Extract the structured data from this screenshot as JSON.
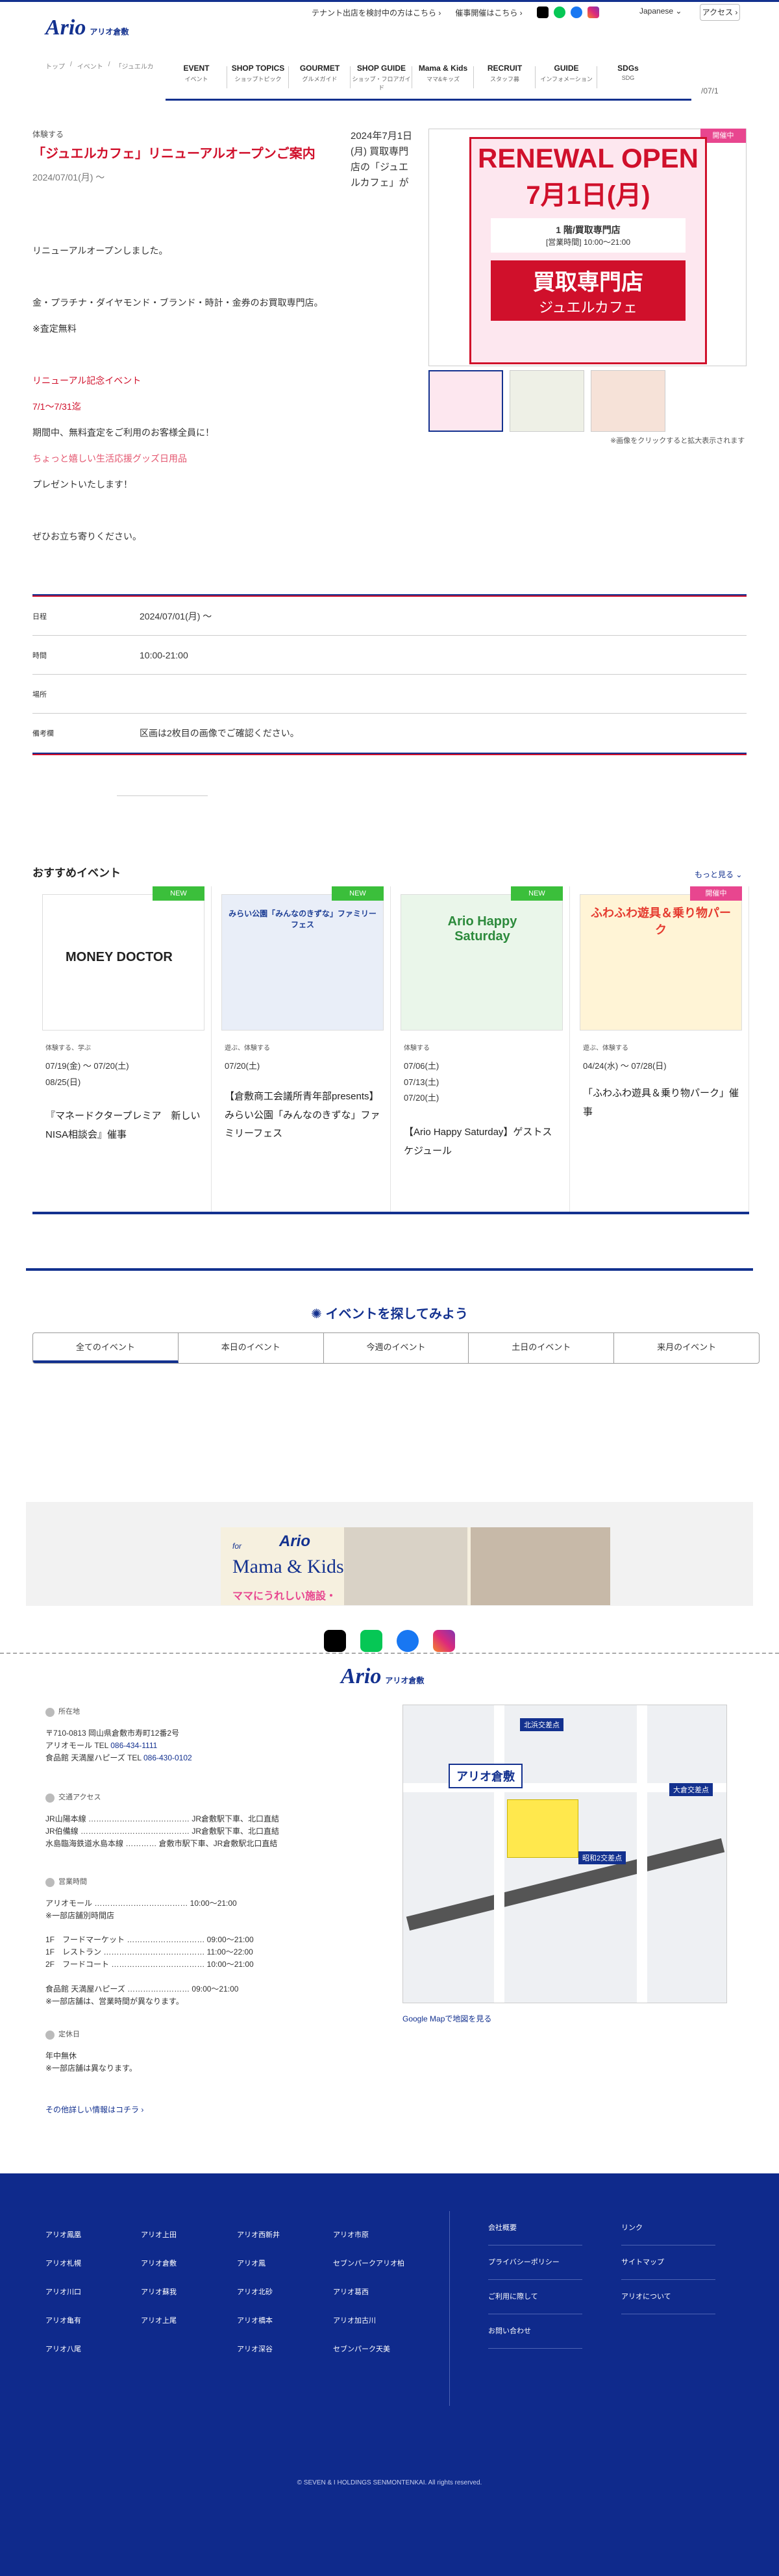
{
  "header": {
    "logo_mark": "Ario",
    "logo_sub": "アリオ倉敷",
    "tenant_link": "テナント出店を検討中の方はこちら ›",
    "venue_link": "催事開催はこちら ›",
    "language": "Japanese ⌄",
    "access": "アクセス ›"
  },
  "breadcrumb": [
    "トップ",
    "/",
    "イベント",
    "/",
    "「ジュエルカ"
  ],
  "gnav": [
    {
      "t": "EVENT",
      "s": "イベント"
    },
    {
      "t": "SHOP TOPICS",
      "s": "ショップトピック"
    },
    {
      "t": "GOURMET",
      "s": "グルメガイド"
    },
    {
      "t": "SHOP GUIDE",
      "s": "ショップ・フロアガイド"
    },
    {
      "t": "Mama & Kids",
      "s": "ママ&キッズ"
    },
    {
      "t": "RECRUIT",
      "s": "スタッフ募"
    },
    {
      "t": "GUIDE",
      "s": "インフォメーション"
    },
    {
      "t": "SDGs",
      "s": "SDG"
    }
  ],
  "header_date": "/07/1",
  "article": {
    "category": "体験する",
    "title": "「ジュエルカフェ」リニューアルオープンご案内",
    "date": "2024/07/01(月) 〜",
    "side_text": "2024年7月1日(月) 買取専門店の「ジュエルカフェ」が",
    "lines": [
      "リニューアルオープンしました。",
      "金・プラチナ・ダイヤモンド・ブランド・時計・金券のお買取専門店。",
      "※査定無料",
      "リニューアル記念イベント",
      "7/1〜7/31迄",
      "期間中、無料査定をご利用のお客様全員に！",
      "ちょっと嬉しい生活応援グッズ日用品",
      "プレゼントいたします！",
      "ぜひお立ち寄りください。"
    ],
    "badge": "開催中",
    "img_text": {
      "line1": "RENEWAL OPEN",
      "line2": "7月1日(月)",
      "floor": "1 階/買取専門店",
      "hours": "[営業時間] 10:00〜21:00",
      "big": "買取専門店",
      "name": "ジュエルカフェ"
    },
    "note": "※画像をクリックすると拡大表示されます"
  },
  "info": [
    {
      "k": "日程",
      "v": "2024/07/01(月) 〜"
    },
    {
      "k": "時間",
      "v": "10:00-21:00"
    },
    {
      "k": "場所",
      "v": ""
    },
    {
      "k": "備考欄",
      "v": "区画は2枚目の画像でご確認ください。"
    }
  ],
  "recommended": {
    "heading": "おすすめイベント",
    "more": "もっと見る ⌄",
    "cards": [
      {
        "badge": "NEW",
        "badge_color": "#3bbf3b",
        "cat": "体験する、学ぶ",
        "dates": [
          "07/19(金) 〜 07/20(土)",
          "08/25(日)"
        ],
        "name": "『マネードクタープレミア　新しいNISA相談会』催事",
        "img_text": "MONEY DOCTOR"
      },
      {
        "badge": "NEW",
        "badge_color": "#3bbf3b",
        "cat": "遊ぶ、体験する",
        "dates": [
          "07/20(土)"
        ],
        "name": "【倉敷商工会議所青年部presents】みらい公園「みんなのきずな」ファミリーフェス",
        "img_text": "みらい公園「みんなのきずな」ファミリーフェス"
      },
      {
        "badge": "NEW",
        "badge_color": "#3bbf3b",
        "cat": "体験する",
        "dates": [
          "07/06(土)",
          "07/13(土)",
          "07/20(土)"
        ],
        "name": "【Ario Happy Saturday】ゲストスケジュール",
        "img_text": "Ario Happy Saturday"
      },
      {
        "badge": "開催中",
        "badge_color": "#e8468f",
        "cat": "遊ぶ、体験する",
        "dates": [
          "04/24(水) 〜 07/28(日)"
        ],
        "name": "「ふわふわ遊具＆乗り物パーク」催事",
        "img_text": "ふわふわ遊具＆乗り物パーク"
      }
    ]
  },
  "search": {
    "heading": "イベントを探してみよう",
    "tabs": [
      "全てのイベント",
      "本日のイベント",
      "今週のイベント",
      "土日のイベント",
      "来月のイベント"
    ]
  },
  "banner": {
    "t1": "for",
    "t2": "Ario",
    "t3": "Mama & Kids",
    "t4": "ママにうれしい施設・"
  },
  "address": {
    "h1": "所在地",
    "addr_lines": [
      "〒710-0813 岡山県倉敷市寿町12番2号",
      "アリオモール TEL ",
      "食品館 天満屋ハピーズ TEL "
    ],
    "tel1": "086-434-1111",
    "tel2": "086-430-0102",
    "h2": "交通アクセス",
    "access": [
      "JR山陽本線 ………………………………… JR倉敷駅下車、北口直結",
      "JR伯備線 …………………………………… JR倉敷駅下車、北口直結",
      "水島臨海鉄道水島本線 ………… 倉敷市駅下車、JR倉敷駅北口直結"
    ],
    "h3": "営業時間",
    "hours": [
      "アリオモール ……………………………… 10:00〜21:00",
      "※一部店舗別時間店",
      "1F　フードマーケット ………………………… 09:00〜21:00",
      "1F　レストラン ………………………………… 11:00〜22:00",
      "2F　フードコート ……………………………… 10:00〜21:00",
      "食品館 天満屋ハピーズ …………………… 09:00〜21:00",
      "※一部店舗は、営業時間が異なります。"
    ],
    "h4": "定休日",
    "holiday": [
      "年中無休",
      "※一部店舗は異なります。"
    ],
    "other": "その他詳しい情報はコチラ ›"
  },
  "map": {
    "label": "アリオ倉敷",
    "kita": "北浜交差点",
    "ookura": "大倉交差点",
    "showa": "昭和2交差点",
    "gmap": "Google Mapで地図を見る"
  },
  "footer": {
    "cols": [
      [
        "アリオ鳳凰",
        "アリオ札幌",
        "アリオ川口",
        "アリオ亀有",
        "アリオ八尾"
      ],
      [
        "アリオ上田",
        "アリオ倉敷",
        "アリオ蘇我",
        "アリオ上尾"
      ],
      [
        "アリオ西新井",
        "アリオ鳳",
        "アリオ北砂",
        "アリオ橋本",
        "アリオ深谷"
      ],
      [
        "アリオ市原",
        "セブンパークアリオ柏",
        "アリオ葛西",
        "アリオ加古川",
        "セブンパーク天美"
      ]
    ],
    "links1": [
      "会社概要",
      "プライバシーポリシー",
      "ご利用に際して",
      "お問い合わせ"
    ],
    "links2": [
      "リンク",
      "サイトマップ",
      "アリオについて"
    ],
    "copyright": "© SEVEN & I HOLDINGS SENMONTENKAI. All rights reserved."
  }
}
